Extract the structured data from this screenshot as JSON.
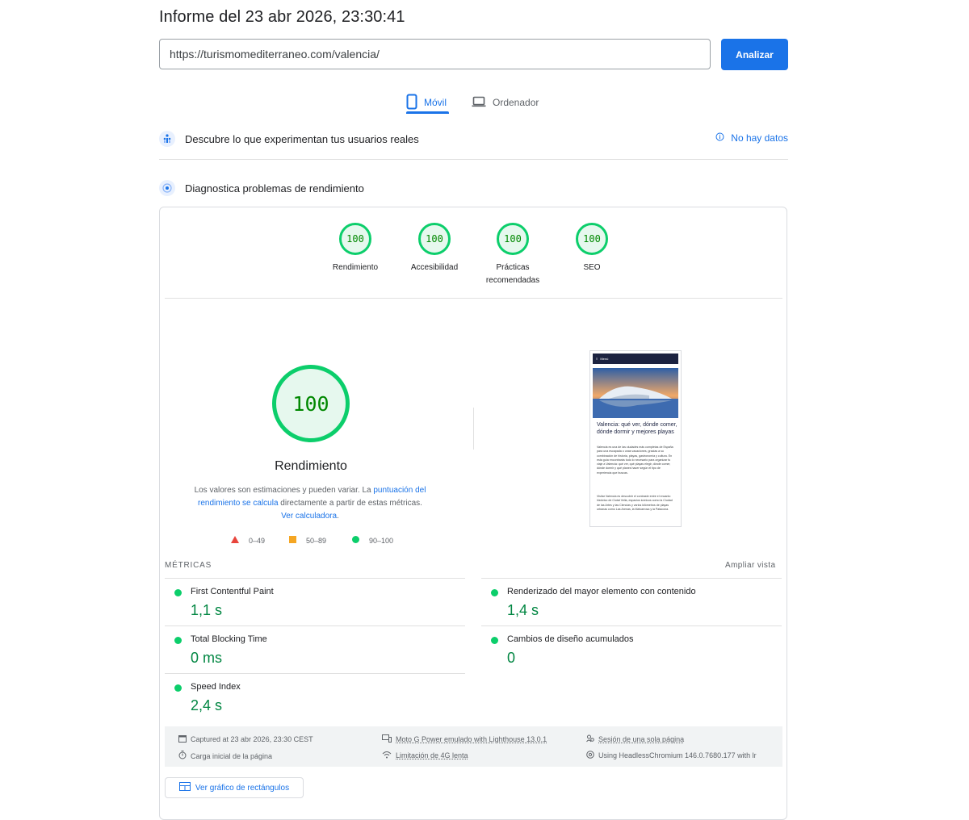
{
  "report": {
    "title": "Informe del 23 abr 2026, 23:30:41"
  },
  "search": {
    "url": "https://turismomediterraneo.com/valencia/",
    "analyze_label": "Analizar"
  },
  "tabs": [
    {
      "label": "Móvil",
      "active": true
    },
    {
      "label": "Ordenador",
      "active": false
    }
  ],
  "field_data": {
    "title": "Descubre lo que experimentan tus usuarios reales",
    "status": "No hay datos"
  },
  "lab_data": {
    "title": "Diagnostica problemas de rendimiento"
  },
  "categories": [
    {
      "score": "100",
      "label": "Rendimiento"
    },
    {
      "score": "100",
      "label": "Accesibilidad"
    },
    {
      "score": "100",
      "label": "Prácticas recomendadas"
    },
    {
      "score": "100",
      "label": "SEO"
    }
  ],
  "performance": {
    "score": "100",
    "title": "Rendimiento",
    "desc_1": "Los valores son estimaciones y pueden variar. La ",
    "desc_link_1": "puntuación del rendimiento se calcula",
    "desc_2": " directamente a partir de estas métricas. ",
    "desc_link_2": "Ver calculadora",
    "desc_3": "."
  },
  "legend": {
    "fail": "0–49",
    "average": "50–89",
    "pass": "90–100"
  },
  "colors": {
    "pass": "#0cce6b",
    "average": "#ffa400",
    "fail": "#ff4e42",
    "accent": "#1a73e8",
    "value_green": "#018642"
  },
  "screenshot": {
    "menu": "Menú",
    "heading": "Valencia: qué ver, dónde comer, dónde dormir y mejores playas",
    "para1": "Valencia es una de las ciudades más completas de España para una escapada o unas vacaciones, gracias a su combinación de historia, playas, gastronomía y cultura. En esta guía encontrarás todo lo necesario para organizar tu viaje a Valencia: qué ver, qué playas elegir, dónde comer, dónde dormir y qué planes hacer según el tipo de experiencia que buscas.",
    "para2": "Visitar Valencia es descubrir el contraste entre el encanto histórico de Ciutat Vella, espacios icónicos como la Ciudad de las Artes y las Ciencias y varios kilómetros de playas urbanas como Las Arenas, la Malvarrosa y la Patacona."
  },
  "metrics": {
    "heading": "MÉTRICAS",
    "expand_label": "Ampliar vista",
    "items": [
      {
        "label": "First Contentful Paint",
        "value": "1,1 s"
      },
      {
        "label": "Renderizado del mayor elemento con contenido",
        "value": "1,4 s"
      },
      {
        "label": "Total Blocking Time",
        "value": "0 ms"
      },
      {
        "label": "Cambios de diseño acumulados",
        "value": "0"
      },
      {
        "label": "Speed Index",
        "value": "2,4 s"
      }
    ]
  },
  "footer": {
    "captured": "Captured at 23 abr 2026, 23:30 CEST",
    "device": "Moto G Power emulado with Lighthouse 13.0.1",
    "session": "Sesión de una sola página",
    "load": "Carga inicial de la página",
    "throttling": "Limitación de 4G lenta",
    "browser": "Using HeadlessChromium 146.0.7680.177 with lr"
  },
  "treemap": {
    "label": "Ver gráfico de rectángulos"
  }
}
